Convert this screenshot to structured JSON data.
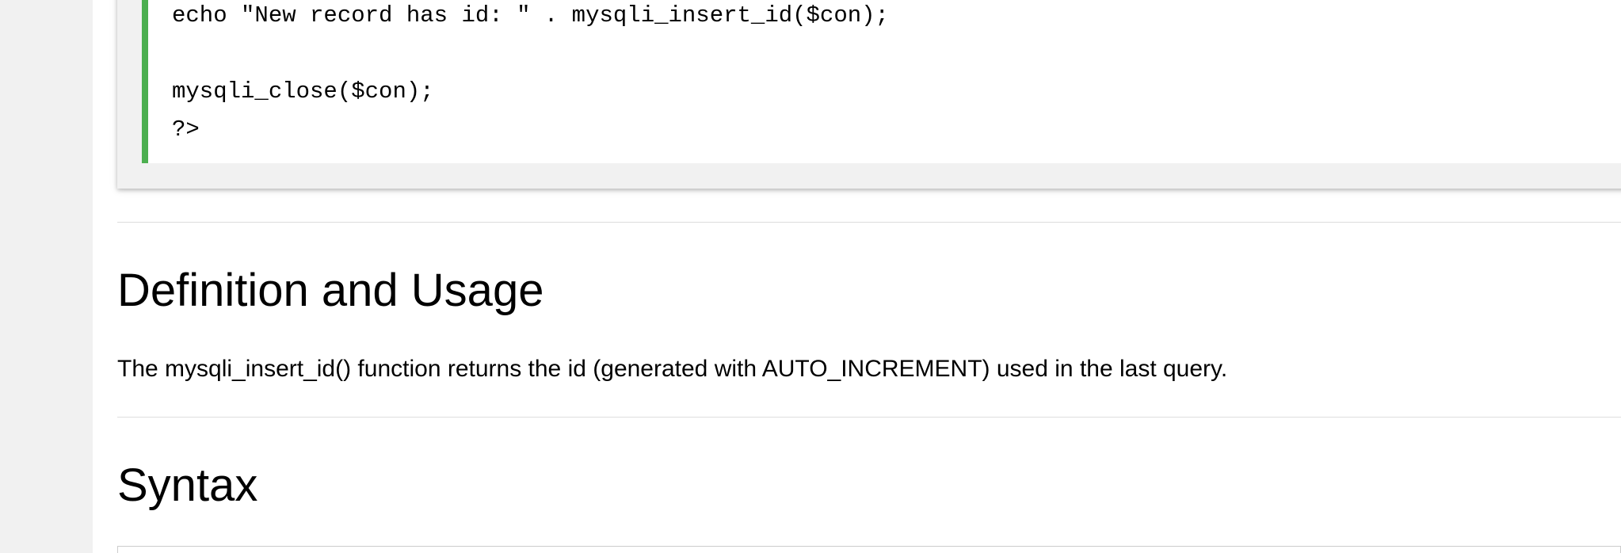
{
  "example": {
    "code_lines": [
      "echo \"New record has id: \" . mysqli_insert_id($con);",
      "",
      "mysqli_close($con);",
      "?>"
    ]
  },
  "definition": {
    "heading": "Definition and Usage",
    "text": "The mysqli_insert_id() function returns the id (generated with AUTO_INCREMENT) used in the last query."
  },
  "syntax": {
    "heading": "Syntax"
  },
  "colors": {
    "code_accent": "#4caf50",
    "panel_background": "#f1f1f1",
    "divider": "#dddddd"
  }
}
